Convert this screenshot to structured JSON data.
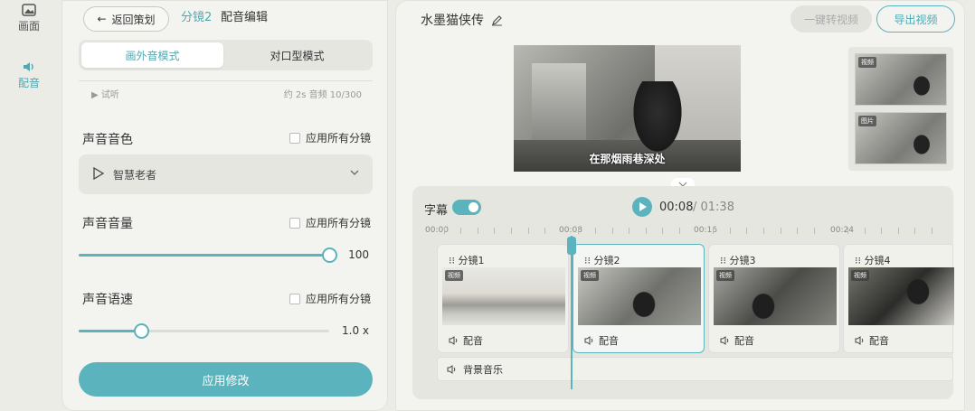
{
  "rail": {
    "items": [
      {
        "label": "画面",
        "icon": "image-icon"
      },
      {
        "label": "配音",
        "icon": "speaker-icon",
        "active": true
      }
    ]
  },
  "left": {
    "back_label": "返回策划",
    "breadcrumb_shot": "分镜2",
    "breadcrumb_page": "配音编辑",
    "modes": [
      "画外音模式",
      "对口型模式"
    ],
    "preview": {
      "play_label": "试听",
      "info": "约 2s 音频 10/300"
    },
    "voice_timbre": {
      "title": "声音音色",
      "apply_all": "应用所有分镜",
      "selected": "智慧老者"
    },
    "volume": {
      "title": "声音音量",
      "apply_all": "应用所有分镜",
      "value": "100",
      "fraction": 1.0
    },
    "speed": {
      "title": "声音语速",
      "apply_all": "应用所有分镜",
      "value": "1.0 x",
      "fraction": 0.25
    },
    "apply_button": "应用修改"
  },
  "right": {
    "project_title": "水墨猫侠传",
    "convert_button": "一键转视频",
    "export_button": "导出视频",
    "subtitle_text": "在那烟雨巷深处",
    "thumb_tags": [
      "视频",
      "图片"
    ],
    "timeline": {
      "subtitle_label": "字幕",
      "current_time": "00:08",
      "total_time": "/ 01:38",
      "ruler_labels": [
        "00:00",
        "00:08",
        "00:16",
        "00:24"
      ],
      "clips": [
        {
          "name": "分镜1",
          "tag": "视频",
          "audio": "配音"
        },
        {
          "name": "分镜2",
          "tag": "视频",
          "audio": "配音"
        },
        {
          "name": "分镜3",
          "tag": "视频",
          "audio": "配音"
        },
        {
          "name": "分镜4",
          "tag": "视频",
          "audio": "配音"
        }
      ],
      "bgm_label": "背景音乐"
    }
  },
  "colors": {
    "accent": "#5bb4bd",
    "background": "#ecece6",
    "panel": "#f3f3ef"
  }
}
